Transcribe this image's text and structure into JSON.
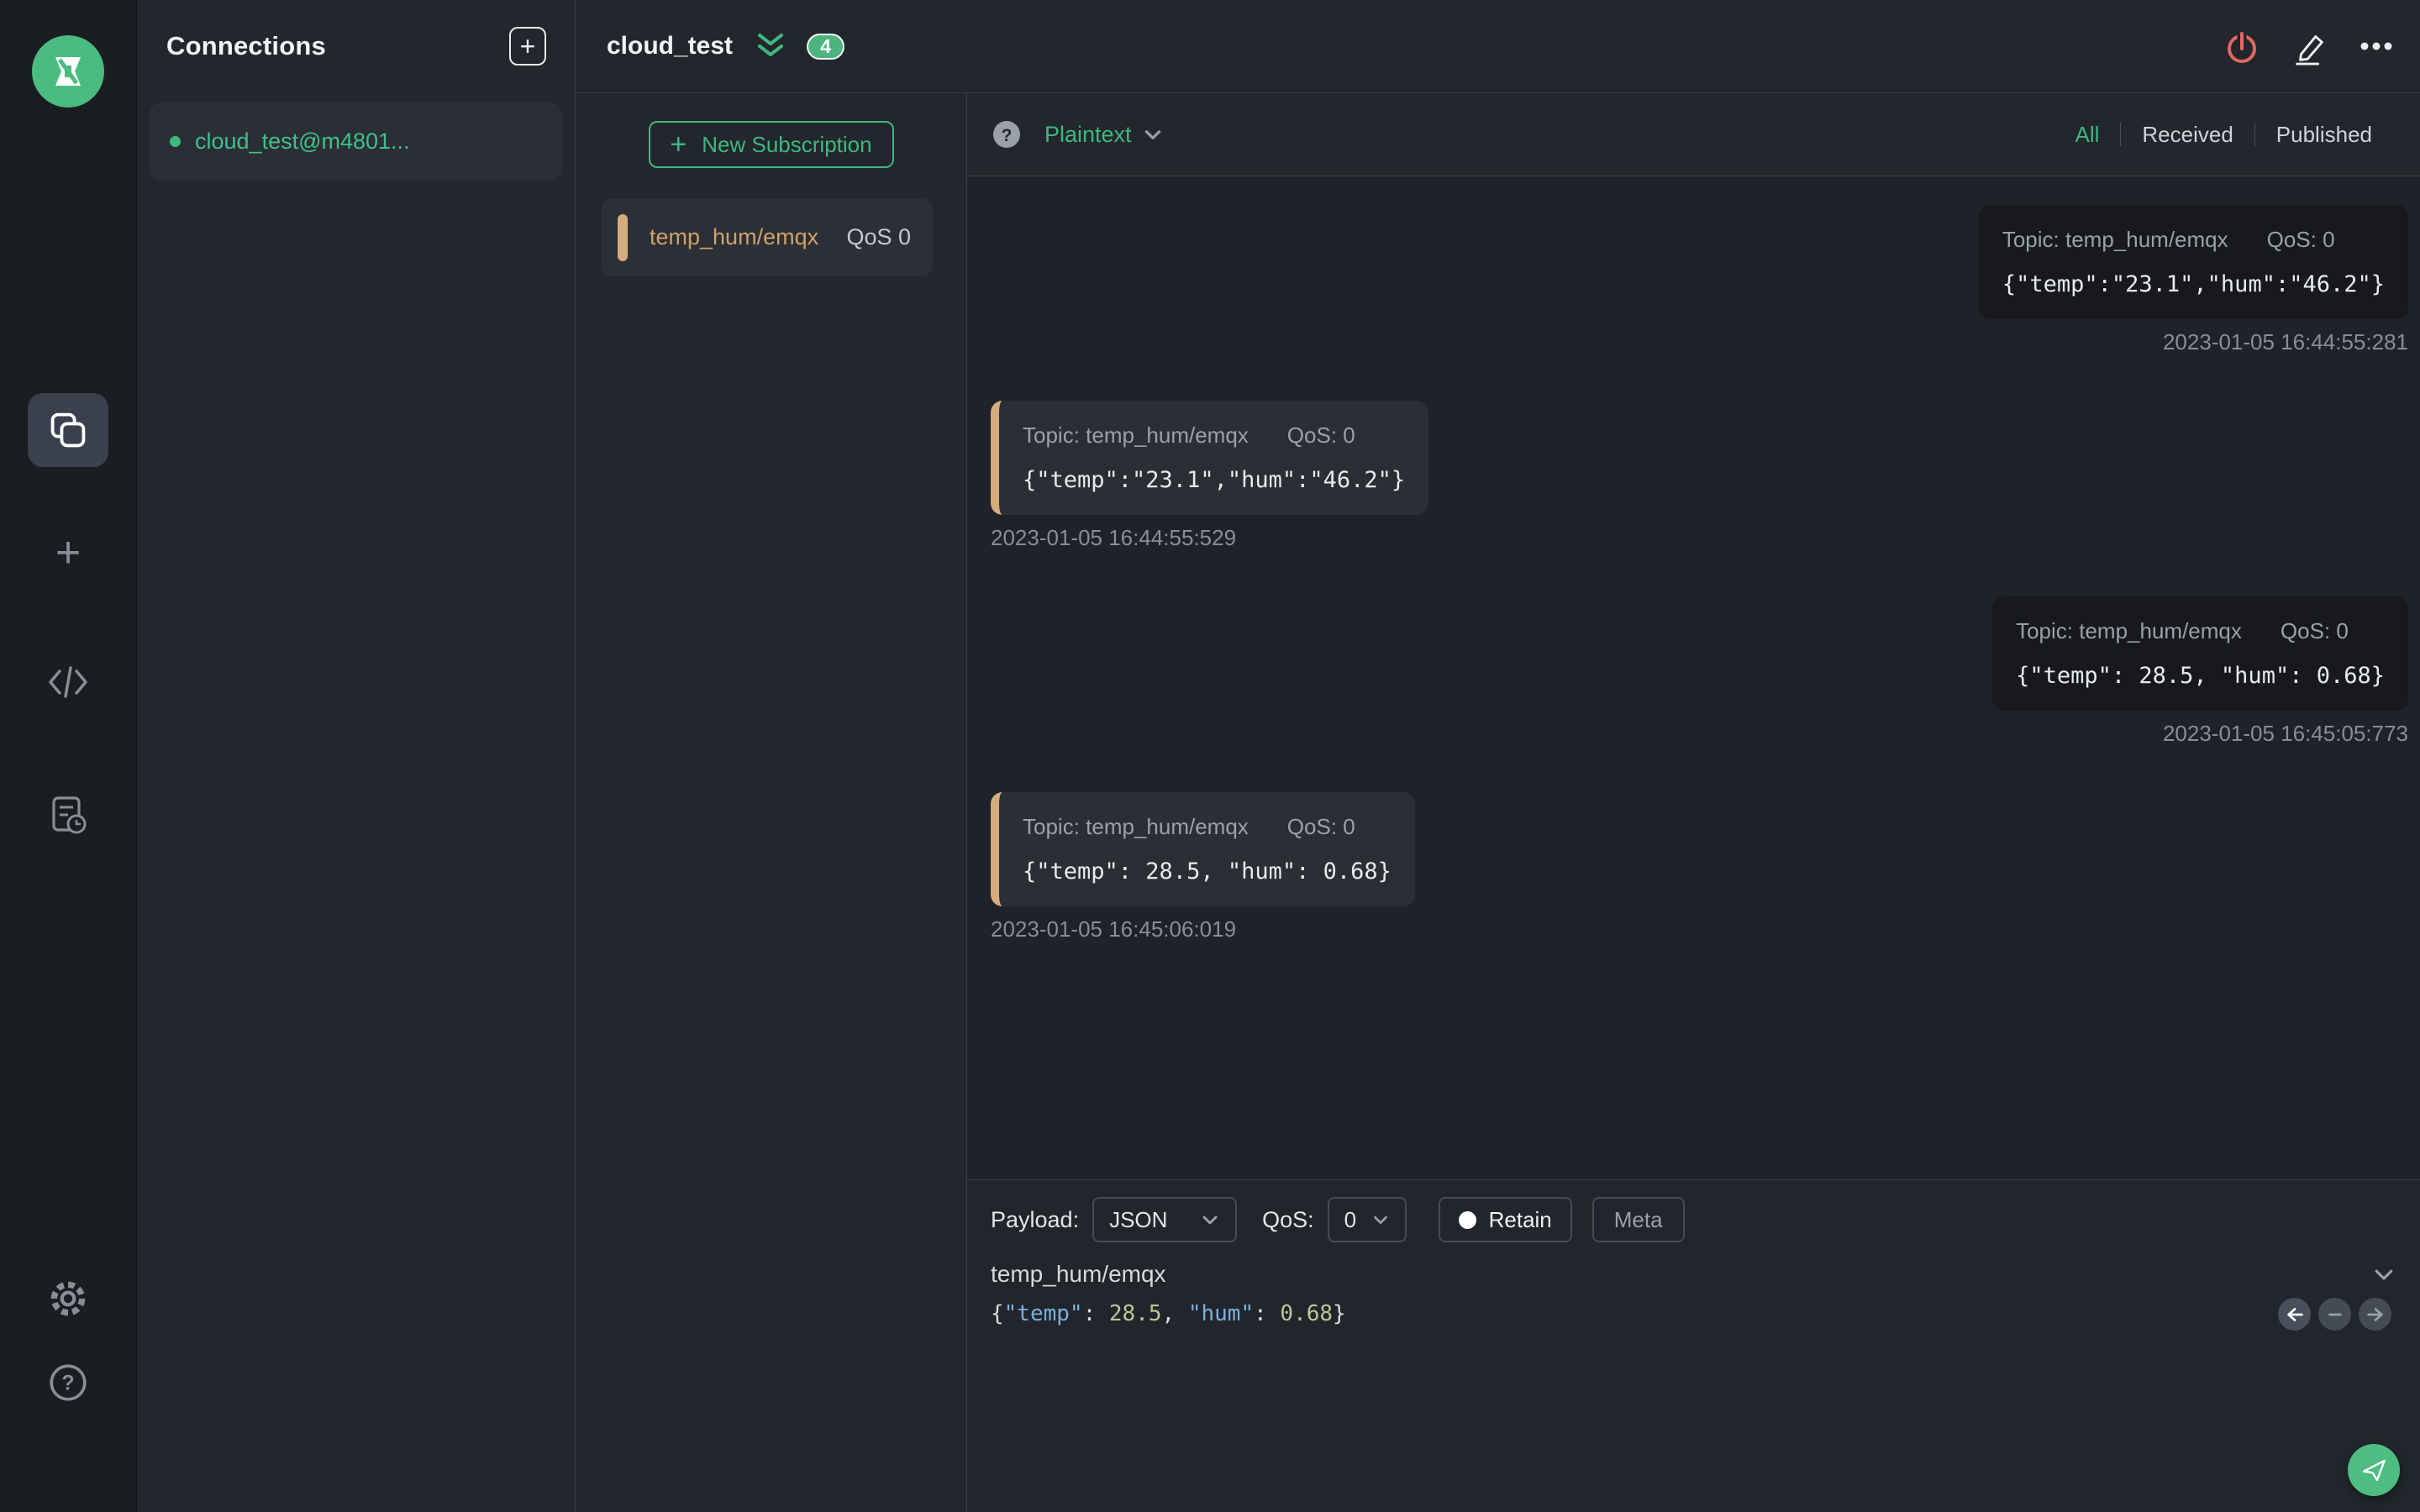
{
  "glyphs": {
    "plus": "+",
    "question": "?"
  },
  "colors": {
    "accent_green": "#3db87f",
    "logo_green": "#4bbc80",
    "subscription_tan": "#d5ac7c",
    "power_red": "#e2685f",
    "editor_key_blue": "#7ab0dc",
    "editor_number_green": "#b6c998",
    "received_bubble": "#2a2e35",
    "published_bubble": "#17191e"
  },
  "icons": {
    "rail": [
      "mqttx-logo",
      "connections-icon",
      "new-connection-plus-icon",
      "script-icon",
      "log-icon",
      "settings-gear-icon",
      "help-icon"
    ],
    "header": [
      "double-chevron-down-icon",
      "power-icon",
      "edit-pencil-icon",
      "more-ellipsis-icon"
    ],
    "publish": [
      "chevron-down-icon",
      "arrow-left-icon",
      "minus-icon",
      "arrow-right-icon",
      "send-plane-icon"
    ]
  },
  "connections_panel": {
    "title": "Connections",
    "connections": [
      {
        "name": "cloud_test@m4801...",
        "status": "connected",
        "status_color": "#3db87f"
      }
    ]
  },
  "subscriptions_panel": {
    "title": "cloud_test",
    "unread_badge": "4",
    "new_subscription_label": "New Subscription",
    "subscriptions": [
      {
        "topic": "temp_hum/emqx",
        "qos_label": "QoS 0",
        "accent_color": "#d5ac7c"
      }
    ]
  },
  "message_view": {
    "payload_format": "Plaintext",
    "filters": [
      {
        "label": "All",
        "active": true
      },
      {
        "label": "Received",
        "active": false
      },
      {
        "label": "Published",
        "active": false
      }
    ],
    "messages": [
      {
        "direction": "published",
        "topic_label": "Topic: temp_hum/emqx",
        "qos_label": "QoS: 0",
        "payload": "{\"temp\":\"23.1\",\"hum\":\"46.2\"}",
        "timestamp": "2023-01-05 16:44:55:281"
      },
      {
        "direction": "received",
        "topic_label": "Topic: temp_hum/emqx",
        "qos_label": "QoS: 0",
        "payload": "{\"temp\":\"23.1\",\"hum\":\"46.2\"}",
        "timestamp": "2023-01-05 16:44:55:529"
      },
      {
        "direction": "published",
        "topic_label": "Topic: temp_hum/emqx",
        "qos_label": "QoS: 0",
        "payload": "{\"temp\": 28.5, \"hum\": 0.68}",
        "timestamp": "2023-01-05 16:45:05:773"
      },
      {
        "direction": "received",
        "topic_label": "Topic: temp_hum/emqx",
        "qos_label": "QoS: 0",
        "payload": "{\"temp\": 28.5, \"hum\": 0.68}",
        "timestamp": "2023-01-05 16:45:06:019"
      }
    ]
  },
  "publish_bar": {
    "payload_label": "Payload:",
    "payload_format": "JSON",
    "qos_label": "QoS:",
    "qos_value": "0",
    "retain_label": "Retain",
    "meta_label": "Meta",
    "topic": "temp_hum/emqx",
    "editor_tokens": [
      {
        "text": "{",
        "kind": "punct"
      },
      {
        "text": "\"temp\"",
        "kind": "key"
      },
      {
        "text": ": ",
        "kind": "punct"
      },
      {
        "text": "28.5",
        "kind": "number"
      },
      {
        "text": ", ",
        "kind": "punct"
      },
      {
        "text": "\"hum\"",
        "kind": "key"
      },
      {
        "text": ": ",
        "kind": "punct"
      },
      {
        "text": "0.68",
        "kind": "number"
      },
      {
        "text": "}",
        "kind": "punct"
      }
    ]
  }
}
